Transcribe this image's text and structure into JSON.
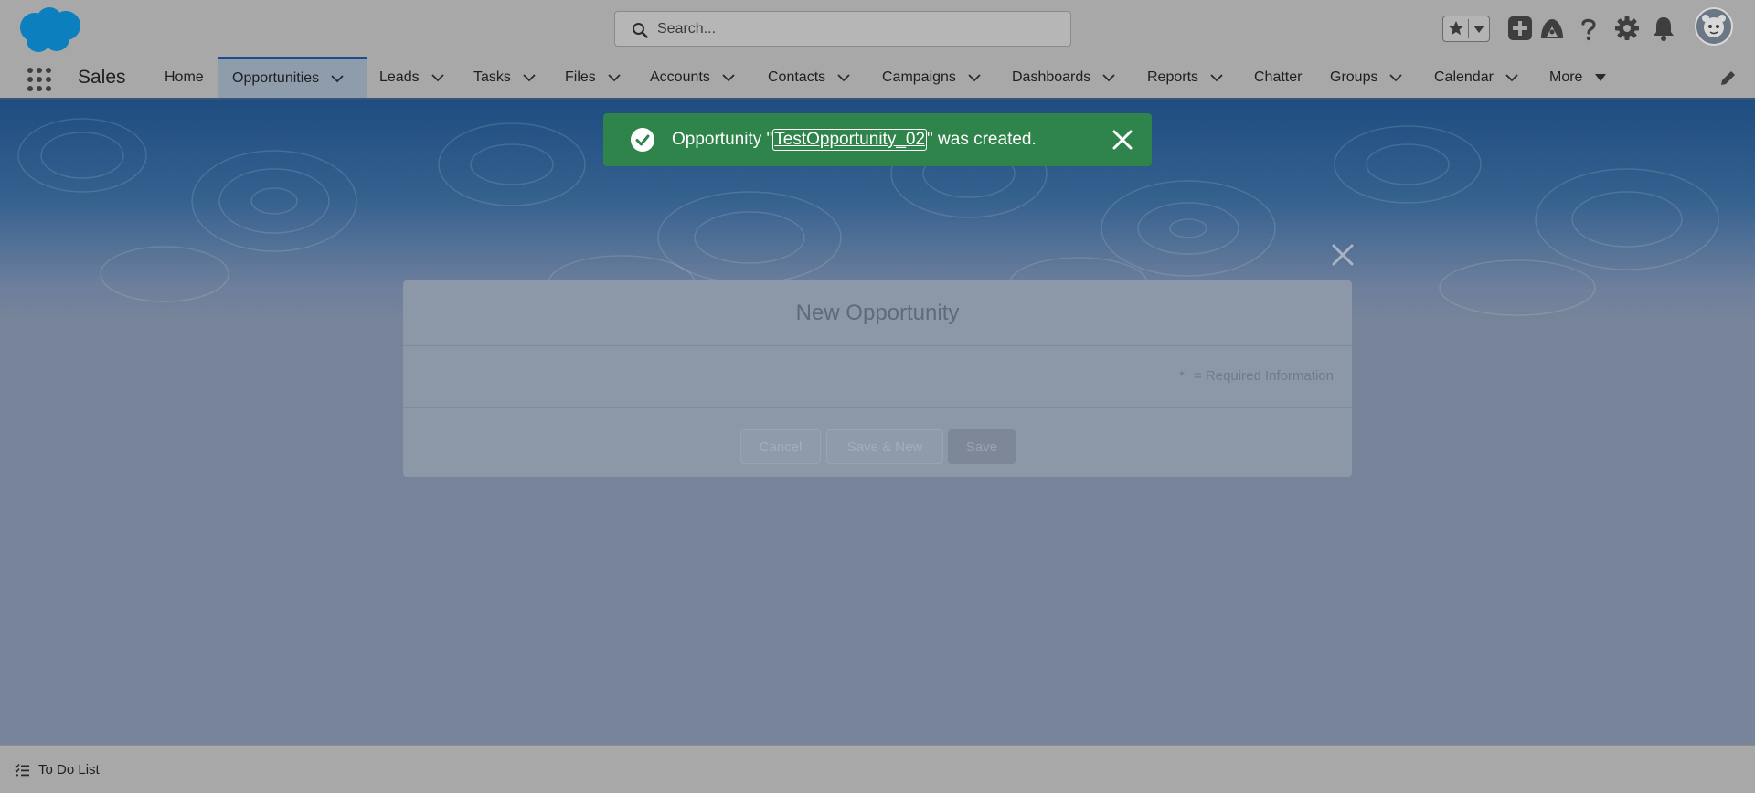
{
  "header": {
    "search_placeholder": "Search...",
    "icons": [
      "salesforce-logo",
      "search-icon",
      "favorites-star-icon",
      "favorites-dropdown-icon",
      "global-add-icon",
      "trailhead-icon",
      "help-icon",
      "setup-gear-icon",
      "notifications-bell-icon",
      "user-avatar"
    ]
  },
  "nav": {
    "app_name": "Sales",
    "items": [
      {
        "label": "Home"
      },
      {
        "label": "Opportunities",
        "active": true
      },
      {
        "label": "Leads"
      },
      {
        "label": "Tasks"
      },
      {
        "label": "Files"
      },
      {
        "label": "Accounts"
      },
      {
        "label": "Contacts"
      },
      {
        "label": "Campaigns"
      },
      {
        "label": "Dashboards"
      },
      {
        "label": "Reports"
      },
      {
        "label": "Chatter"
      },
      {
        "label": "Groups"
      },
      {
        "label": "Calendar"
      },
      {
        "label": "More"
      }
    ]
  },
  "modal": {
    "title": "New Opportunity",
    "required_star": "*",
    "required_text": "= Required Information",
    "buttons": {
      "cancel": "Cancel",
      "save_new": "Save & New",
      "save": "Save"
    }
  },
  "toast": {
    "prefix": "Opportunity \"",
    "record_name": "TestOpportunity_02",
    "suffix": "\" was created.",
    "color": "#2e844a"
  },
  "utility_bar": {
    "todo_label": "To Do List"
  },
  "colors": {
    "brand": "#0b5cab",
    "banner": "#1f4d80",
    "success": "#2e844a"
  }
}
